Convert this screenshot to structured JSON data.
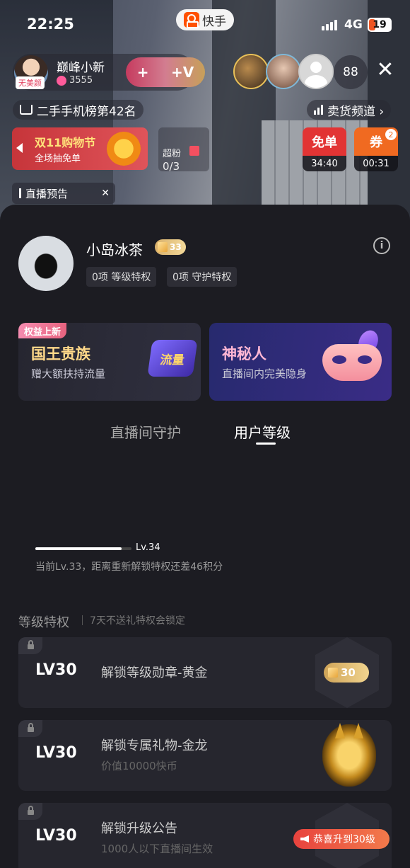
{
  "status_bar": {
    "time": "22:25",
    "app_name": "快手",
    "network": "4G",
    "battery": "19"
  },
  "stream": {
    "host_name": "巅峰小新",
    "host_badge": "无美颜",
    "likes": "3555",
    "follow_plus": "+",
    "follow_v": "+V",
    "viewer_count": "88",
    "close": "✕",
    "rank_label": "二手手机榜第42名",
    "shop_channel": "卖货频道 ›",
    "promo_title": "双11购物节",
    "promo_sub": "全场抽免单",
    "task_label": "超粉",
    "task_progress": "0/3",
    "coupon1_label": "免单",
    "coupon1_timer": "34:40",
    "coupon2_label": "券",
    "coupon2_timer": "00:31",
    "coupon2_count": "2",
    "preview_label": "直播预告",
    "preview_close": "✕"
  },
  "profile": {
    "name": "小岛冰茶",
    "level": "33",
    "level_privileges": "0项 等级特权",
    "guard_privileges": "0项 守护特权",
    "info": "i"
  },
  "cards": [
    {
      "ribbon": "权益上新",
      "title": "国王贵族",
      "subtitle": "赠大额扶持流量",
      "badge": "流量"
    },
    {
      "title": "神秘人",
      "subtitle": "直播间内完美隐身"
    }
  ],
  "tabs": {
    "guard": "直播间守护",
    "level": "用户等级"
  },
  "progress": {
    "next_level": "Lv.34",
    "fill_fraction": 0.9,
    "tip": "当前Lv.33，距离重新解锁特权还差46积分"
  },
  "privileges": {
    "title": "等级特权",
    "note": "7天不送礼特权会锁定",
    "items": [
      {
        "level": "LV30",
        "title": "解锁等级勋章-黄金",
        "subtitle": "",
        "badge": "30"
      },
      {
        "level": "LV30",
        "title": "解锁专属礼物-金龙",
        "subtitle": "价值10000快币"
      },
      {
        "level": "LV30",
        "title": "解锁升级公告",
        "subtitle": "1000人以下直播间生效"
      }
    ]
  },
  "toast": "恭喜升到30级"
}
